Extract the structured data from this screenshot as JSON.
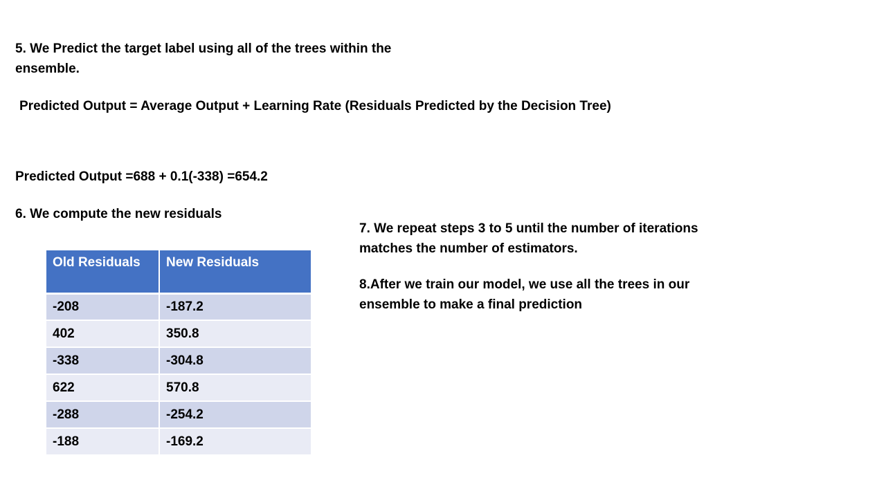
{
  "slide": {
    "step5": "5. We Predict the target label using all of the trees within the ensemble.",
    "formula": "Predicted Output = Average Output + Learning Rate (Residuals Predicted by the Decision Tree)",
    "calculation": "Predicted Output =688 + 0.1(-338)  =654.2",
    "step6": "6. We compute the new residuals",
    "step7": "7. We repeat steps 3 to 5 until the number of iterations matches the number of estimators.",
    "step8": "8.After we train our model, we use all the trees  in our ensemble to make a final prediction"
  },
  "table": {
    "headers": [
      "Old Residuals",
      "New Residuals"
    ],
    "rows": [
      [
        "-208",
        "-187.2"
      ],
      [
        "402",
        "350.8"
      ],
      [
        "-338",
        "-304.8"
      ],
      [
        "622",
        "570.8"
      ],
      [
        "-288",
        "-254.2"
      ],
      [
        "-188",
        "-169.2"
      ]
    ]
  },
  "colors": {
    "header_bg": "#4472c4",
    "row_odd_bg": "#cfd5ea",
    "row_even_bg": "#e9ebf5"
  }
}
